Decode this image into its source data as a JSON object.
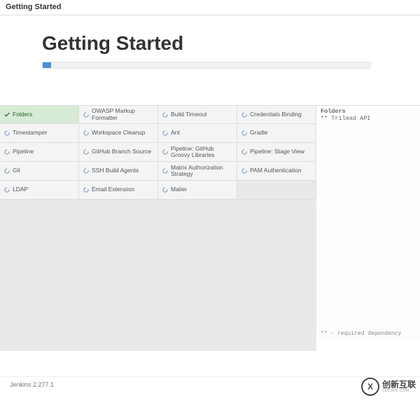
{
  "topbar": {
    "title": "Getting Started"
  },
  "header": {
    "heading": "Getting Started",
    "progress_percent": 2.5
  },
  "plugins": [
    {
      "label": "Folders",
      "state": "done"
    },
    {
      "label": "OWASP Markup Formatter",
      "state": "pending"
    },
    {
      "label": "Build Timeout",
      "state": "pending"
    },
    {
      "label": "Credentials Binding",
      "state": "pending"
    },
    {
      "label": "Timestamper",
      "state": "pending"
    },
    {
      "label": "Workspace Cleanup",
      "state": "pending"
    },
    {
      "label": "Ant",
      "state": "pending"
    },
    {
      "label": "Gradle",
      "state": "pending"
    },
    {
      "label": "Pipeline",
      "state": "pending"
    },
    {
      "label": "GitHub Branch Source",
      "state": "pending"
    },
    {
      "label": "Pipeline: GitHub Groovy Libraries",
      "state": "pending"
    },
    {
      "label": "Pipeline: Stage View",
      "state": "pending"
    },
    {
      "label": "Git",
      "state": "pending"
    },
    {
      "label": "SSH Build Agents",
      "state": "pending"
    },
    {
      "label": "Matrix Authorization Strategy",
      "state": "pending"
    },
    {
      "label": "PAM Authentication",
      "state": "pending"
    },
    {
      "label": "LDAP",
      "state": "pending"
    },
    {
      "label": "Email Extension",
      "state": "pending"
    },
    {
      "label": "Mailer",
      "state": "pending"
    }
  ],
  "log": {
    "title": "Folders",
    "lines": [
      "** Trilead API"
    ],
    "footer": "** - required dependency"
  },
  "footer": {
    "version": "Jenkins 2.277.1"
  },
  "watermark": {
    "logo_letter": "X",
    "text": "创新互联",
    "sub": "CDCXHL.COM"
  }
}
